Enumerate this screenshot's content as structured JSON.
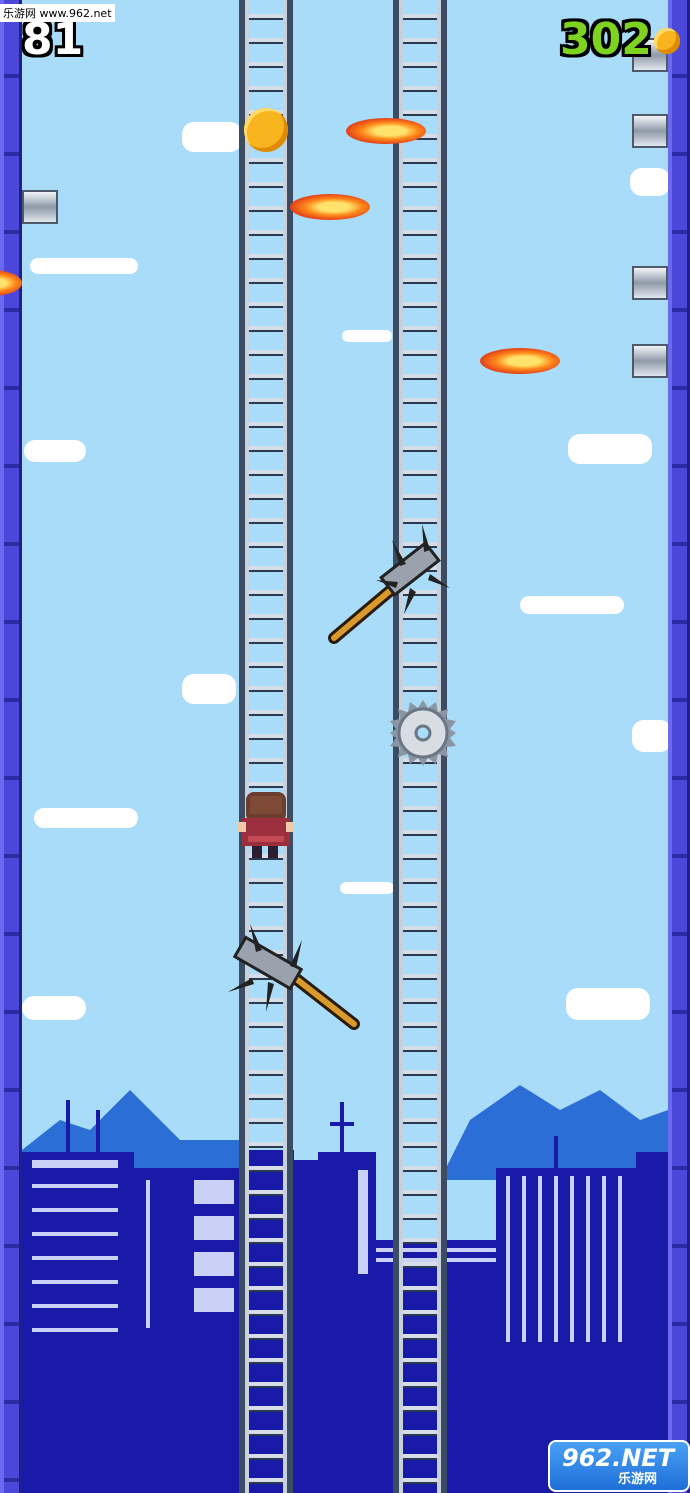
{
  "hud": {
    "level": "81",
    "coins": "302",
    "coin_icon": "coin-icon"
  },
  "watermark": {
    "top": "乐游网 www.962.net",
    "bottom_brand": "962.NET",
    "bottom_sub": "乐游网"
  },
  "colors": {
    "sky": "#a8dcf9",
    "wall": "#4b47d8",
    "city": "#1a1aa8",
    "mountains": "#2b6ed6",
    "coins_text": "#7ed321"
  },
  "entities": {
    "player": "player-character",
    "hazards": [
      "fireball",
      "fireball",
      "fireball",
      "fireball",
      "saw-blade",
      "spiked-hammer",
      "spiked-hammer"
    ],
    "wall_cannons": 6
  }
}
